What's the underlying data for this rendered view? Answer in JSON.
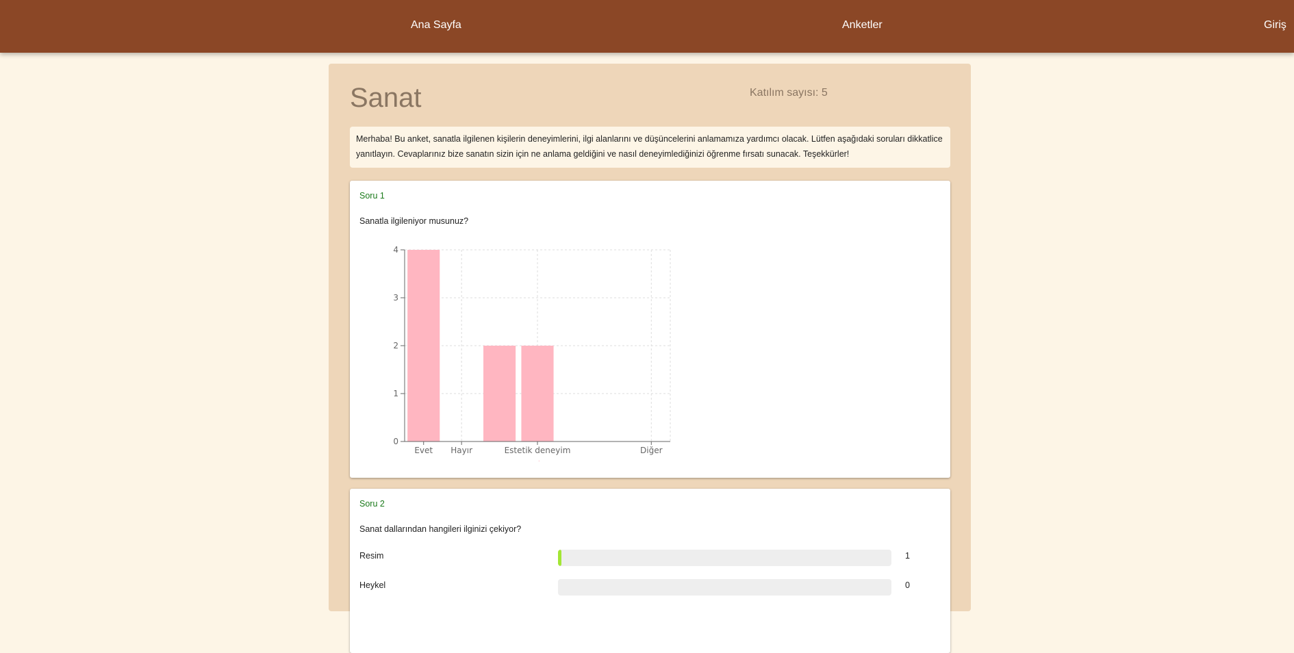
{
  "nav": {
    "home": "Ana Sayfa",
    "surveys": "Anketler",
    "login": "Giriş"
  },
  "survey": {
    "title": "Sanat",
    "participation": "Katılım sayısı: 5",
    "intro": "Merhaba! Bu anket, sanatla ilgilenen kişilerin deneyimlerini, ilgi alanlarını ve düşüncelerini anlamamıza yardımcı olacak. Lütfen aşağıdaki soruları dikkatlice yanıtlayın. Cevaplarınız bize sanatın sizin için ne anlama geldiğini ve nasıl deneyimlediğinizi öğrenme fırsatı sunacak. Teşekkürler!"
  },
  "questions": [
    {
      "number": "Soru 1",
      "text": "Sanatla ilgileniyor musunuz?"
    },
    {
      "number": "Soru 2",
      "text": "Sanat dallarından hangileri ilginizi çekiyor?",
      "options": [
        {
          "label": "Resim",
          "count": "1",
          "fraction": 0.01
        },
        {
          "label": "Heykel",
          "count": "0",
          "fraction": 0
        }
      ]
    }
  ],
  "chart_data": {
    "type": "bar",
    "categories": [
      "Evet",
      "Hayır",
      "",
      "Estetik deneyim",
      "",
      "",
      "Diğer"
    ],
    "series": [
      {
        "name": "value",
        "values": [
          4,
          0,
          2,
          2,
          0,
          0,
          0
        ],
        "color": "#ffb6c1"
      }
    ],
    "yticks": [
      "0",
      "1",
      "2",
      "3",
      "4"
    ],
    "ylim": [
      0,
      4
    ],
    "grid": true,
    "legend": "bottom",
    "title": "",
    "xlabel": "",
    "ylabel": ""
  }
}
